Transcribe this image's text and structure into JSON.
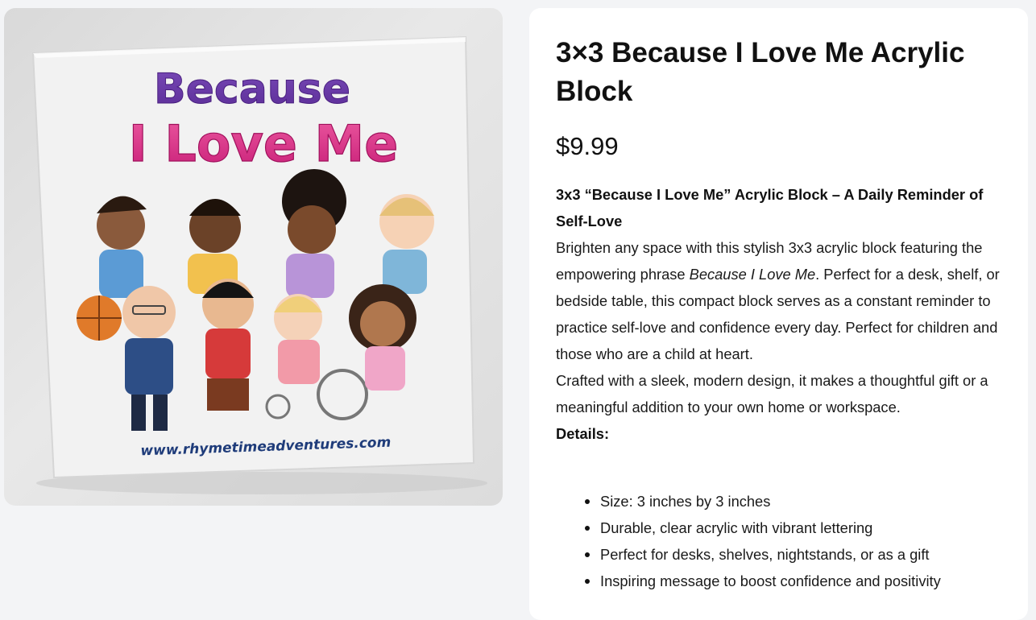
{
  "product": {
    "title": "3×3 Because I Love Me Acrylic Block",
    "price": "$9.99",
    "image": {
      "line1": "Because",
      "line2": "I Love Me",
      "url_text": "www.rhymetimeadventures.com"
    },
    "description": {
      "headline": "3x3 “Because I Love Me” Acrylic Block – A Daily Reminder of Self-Love",
      "para1_start": "Brighten any space with this stylish 3x3 acrylic block featuring the empowering phrase ",
      "para1_em": "Because I Love Me",
      "para1_end": ". Perfect for a desk, shelf, or bedside table, this compact block serves as a constant reminder to practice self-love and confidence every day. Perfect for children and those who are a child at heart.",
      "para2": "Crafted with a sleek, modern design, it makes a thoughtful gift or a meaningful addition to your own home or workspace.",
      "details_label": "Details:"
    },
    "features": [
      "Size: 3 inches by 3 inches",
      "Durable, clear acrylic with vibrant lettering",
      "Perfect for desks, shelves, nightstands, or as a gift",
      "Inspiring message to boost confidence and positivity"
    ]
  }
}
